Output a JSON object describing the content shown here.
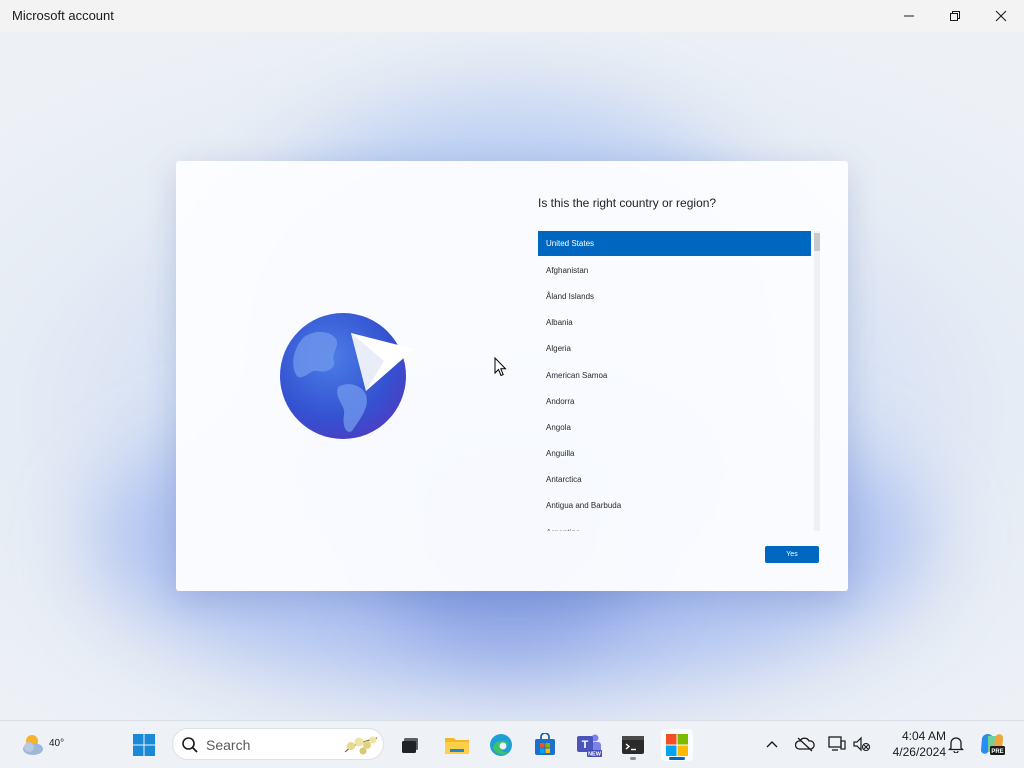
{
  "window": {
    "title": "Microsoft account"
  },
  "dialog": {
    "question": "Is this the right country or region?",
    "countries": [
      "United States",
      "Afghanistan",
      "Åland Islands",
      "Albania",
      "Algeria",
      "American Samoa",
      "Andorra",
      "Angola",
      "Anguilla",
      "Antarctica",
      "Antigua and Barbuda",
      "Argentina"
    ],
    "selected": "United States",
    "primary_button": "Yes"
  },
  "taskbar": {
    "weather_temp": "40°",
    "search_placeholder": "Search",
    "clock_time": "4:04 AM",
    "clock_date": "4/26/2024",
    "apps": [
      {
        "icon": "windows-start-icon"
      },
      {
        "icon": "task-view-icon"
      },
      {
        "icon": "file-explorer-icon"
      },
      {
        "icon": "edge-browser-icon"
      },
      {
        "icon": "microsoft-store-icon"
      },
      {
        "icon": "teams-new-icon",
        "badge": "NEW"
      },
      {
        "icon": "terminal-icon"
      },
      {
        "icon": "microsoft-account-icon"
      }
    ],
    "copilot_badge": "PRE"
  },
  "colors": {
    "accent": "#0067c0",
    "titlebar": "#f3f3f3",
    "taskbar": "#eef1f6"
  }
}
